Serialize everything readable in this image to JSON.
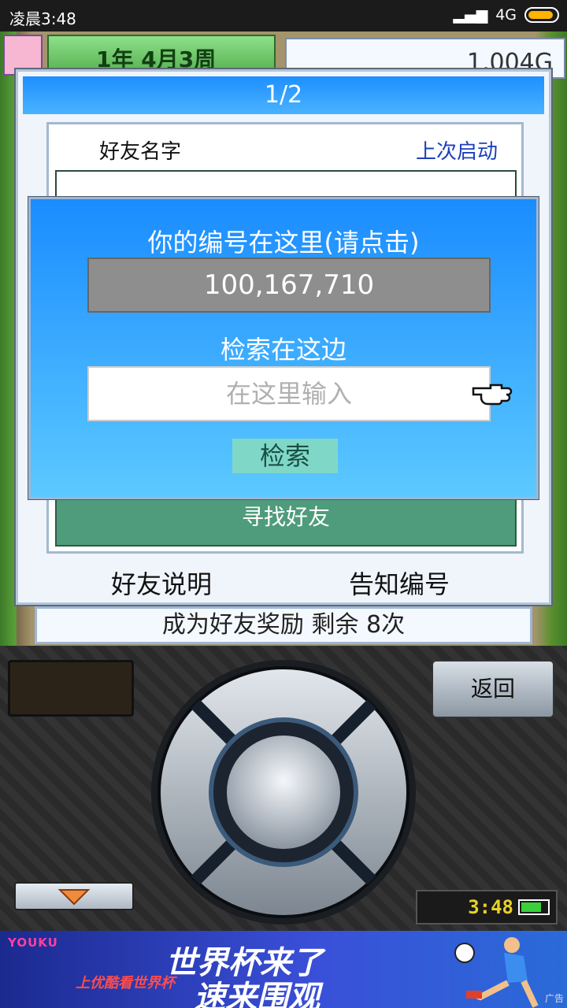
{
  "statusbar": {
    "time": "凌晨3:48",
    "network": "4G"
  },
  "game": {
    "date_label": "1年 4月3周",
    "money": "1,004G"
  },
  "panel": {
    "page": "1/2",
    "col_name": "好友名字",
    "col_last_login": "上次启动",
    "find_friend_button": "寻找好友",
    "friend_help_link": "好友说明",
    "notify_id_link": "告知编号"
  },
  "dialog": {
    "title": "你的编号在这里(请点击)",
    "player_id": "100,167,710",
    "search_label": "检索在这边",
    "search_placeholder": "在这里输入",
    "search_button": "检索"
  },
  "reward": {
    "text": "成为好友奖励 剩余 8次"
  },
  "controller": {
    "back_button": "返回",
    "clock": "3:48"
  },
  "ad": {
    "brand": "YOUKU",
    "line1": "世界杯来了",
    "line2": "速来围观",
    "small": "上优酷看世界杯",
    "tag": "广告"
  }
}
